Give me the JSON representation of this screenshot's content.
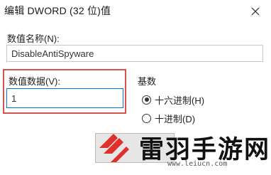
{
  "window": {
    "title": "编辑 DWORD (32 位)值"
  },
  "name_field": {
    "label": "数值名称(N):",
    "value": "DisableAntiSpyware"
  },
  "data_field": {
    "label": "数值数据(V):",
    "value": "1"
  },
  "base_group": {
    "label": "基数",
    "options": [
      {
        "label": "十六进制(H)",
        "selected": true
      },
      {
        "label": "十进制(D)",
        "selected": false
      }
    ]
  },
  "watermark": {
    "brand": "雷羽手游网",
    "url": "www.leiucn.com"
  },
  "colors": {
    "highlight_frame": "#d5524f",
    "focus_border": "#0078d7",
    "logo": "#e0302b"
  }
}
